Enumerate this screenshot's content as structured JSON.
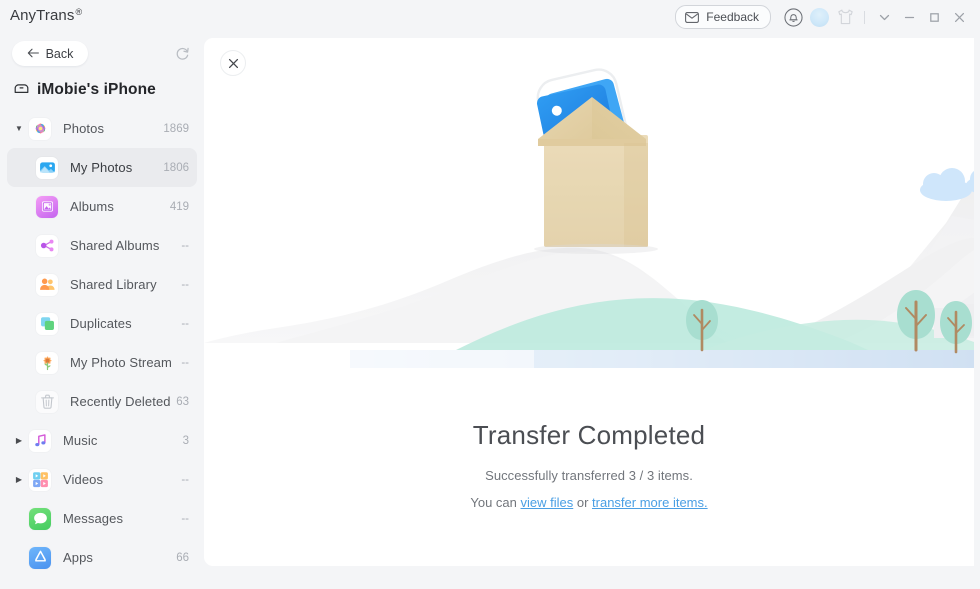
{
  "titlebar": {
    "brand": "AnyTrans",
    "registered_mark": "®",
    "feedback_label": "Feedback",
    "icons": {
      "mail": "mail-icon",
      "bell": "bell-icon",
      "avatar": "avatar-icon",
      "shirt": "shirt-icon",
      "chevron_down": "chevron-down-icon",
      "minimize": "minimize-icon",
      "maximize": "maximize-icon",
      "close": "close-icon"
    }
  },
  "sidebar": {
    "back_label": "Back",
    "refresh_icon": "refresh-icon",
    "device_name": "iMobie's iPhone",
    "device_icon": "device-iphone-icon",
    "items": [
      {
        "label": "Photos",
        "count": "1869",
        "icon": "photos-icon",
        "level": 0,
        "caret": "expanded",
        "selected": false
      },
      {
        "label": "My Photos",
        "count": "1806",
        "icon": "my-photos-icon",
        "level": 1,
        "caret": "none",
        "selected": true
      },
      {
        "label": "Albums",
        "count": "419",
        "icon": "albums-icon",
        "level": 1,
        "caret": "none",
        "selected": false
      },
      {
        "label": "Shared Albums",
        "count": "--",
        "icon": "shared-albums-icon",
        "level": 1,
        "caret": "none",
        "selected": false
      },
      {
        "label": "Shared Library",
        "count": "--",
        "icon": "shared-library-icon",
        "level": 1,
        "caret": "none",
        "selected": false
      },
      {
        "label": "Duplicates",
        "count": "--",
        "icon": "duplicates-icon",
        "level": 1,
        "caret": "none",
        "selected": false
      },
      {
        "label": "My Photo Stream",
        "count": "--",
        "icon": "photo-stream-icon",
        "level": 1,
        "caret": "none",
        "selected": false
      },
      {
        "label": "Recently Deleted",
        "count": "63",
        "icon": "trash-icon",
        "level": 1,
        "caret": "none",
        "selected": false
      },
      {
        "label": "Music",
        "count": "3",
        "icon": "music-icon",
        "level": 0,
        "caret": "collapsed",
        "selected": false
      },
      {
        "label": "Videos",
        "count": "--",
        "icon": "videos-icon",
        "level": 0,
        "caret": "collapsed",
        "selected": false
      },
      {
        "label": "Messages",
        "count": "--",
        "icon": "messages-icon",
        "level": 0,
        "caret": "none",
        "selected": false
      },
      {
        "label": "Apps",
        "count": "66",
        "icon": "apps-icon",
        "level": 0,
        "caret": "none",
        "selected": false
      }
    ]
  },
  "main": {
    "close_icon": "close-icon",
    "illustration": "transfer-complete-box-illustration",
    "title": "Transfer Completed",
    "subtitle": "Successfully transferred 3 / 3 items.",
    "links_prefix": "You can ",
    "link_view_files": "view files",
    "links_middle": " or ",
    "link_transfer_more": "transfer more items.",
    "accent_link_color": "#4a9fe4"
  }
}
